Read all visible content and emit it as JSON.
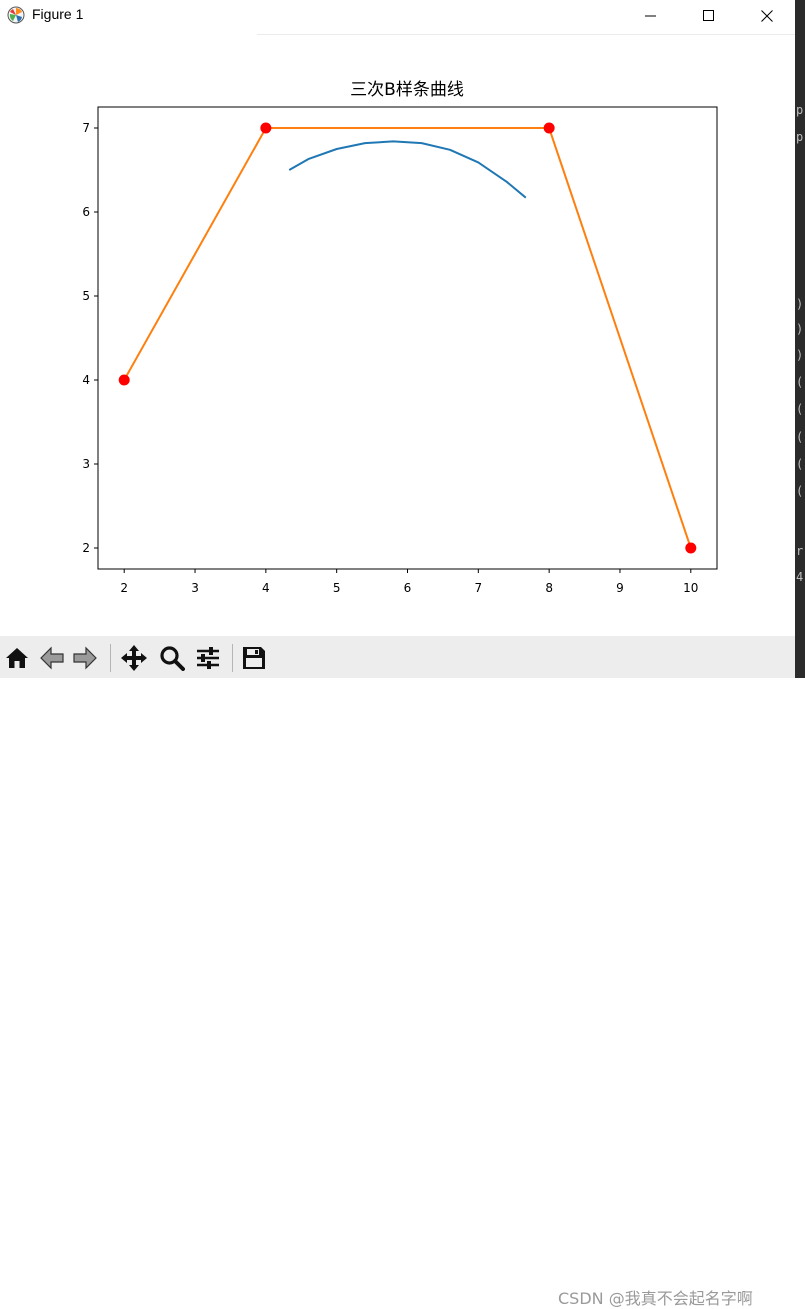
{
  "window": {
    "title": "Figure 1",
    "min_symbol": "—",
    "max_symbol": "☐",
    "close_symbol": "✕"
  },
  "right_strip_chars": [
    "p",
    "p",
    ")",
    ")",
    ")",
    "(",
    "(",
    "(",
    "(",
    "(",
    "r",
    "4"
  ],
  "toolbar": {
    "buttons": [
      {
        "name": "home-button",
        "icon": "home-icon"
      },
      {
        "name": "back-button",
        "icon": "arrow-left-icon"
      },
      {
        "name": "forward-button",
        "icon": "arrow-right-icon"
      },
      {
        "name": "pan-button",
        "icon": "move-icon"
      },
      {
        "name": "zoom-button",
        "icon": "magnifier-icon"
      },
      {
        "name": "configure-subplots-button",
        "icon": "sliders-icon"
      },
      {
        "name": "save-button",
        "icon": "floppy-disk-icon"
      }
    ]
  },
  "watermark": "CSDN @我真不会起名字啊",
  "chart_data": {
    "type": "line",
    "title": "三次B样条曲线",
    "xlabel": "",
    "ylabel": "",
    "xlim": [
      1.63,
      10.37
    ],
    "ylim": [
      1.75,
      7.25
    ],
    "xticks": [
      2,
      3,
      4,
      5,
      6,
      7,
      8,
      9,
      10
    ],
    "yticks": [
      2,
      3,
      4,
      5,
      6,
      7
    ],
    "grid": false,
    "series": [
      {
        "color": "#1f77b4",
        "x": [
          4.33,
          4.6,
          5.0,
          5.4,
          5.8,
          6.2,
          6.6,
          7.0,
          7.4,
          7.67
        ],
        "y": [
          6.5,
          6.63,
          6.75,
          6.82,
          6.84,
          6.82,
          6.74,
          6.59,
          6.36,
          6.17
        ]
      },
      {
        "color": "#ff7f0e",
        "x": [
          2,
          4,
          8,
          10
        ],
        "y": [
          4,
          7,
          7,
          2
        ]
      }
    ],
    "control_points": {
      "color": "#ff0000",
      "x": [
        2,
        4,
        8,
        10
      ],
      "y": [
        4,
        7,
        7,
        2
      ]
    }
  }
}
